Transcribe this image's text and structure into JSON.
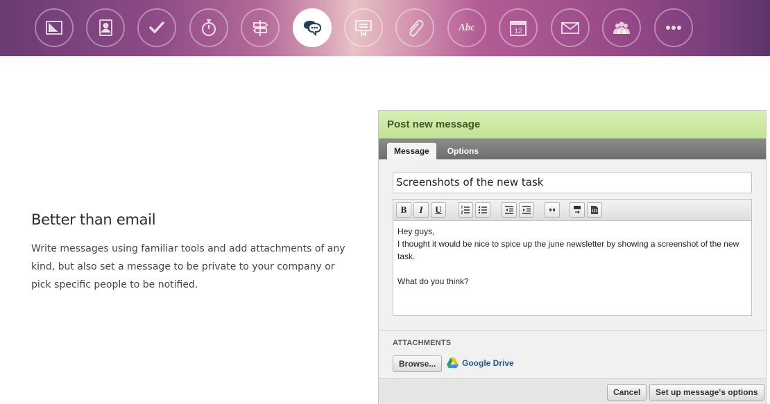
{
  "nav": {
    "icons": [
      {
        "name": "design-icon"
      },
      {
        "name": "contacts-icon"
      },
      {
        "name": "checkmark-icon"
      },
      {
        "name": "timer-icon"
      },
      {
        "name": "signpost-icon"
      },
      {
        "name": "messages-icon",
        "active": true
      },
      {
        "name": "notes-icon"
      },
      {
        "name": "attachment-icon"
      },
      {
        "name": "spelling-icon",
        "text": "Abc"
      },
      {
        "name": "calendar-icon",
        "text": "12"
      },
      {
        "name": "mail-icon"
      },
      {
        "name": "people-icon"
      },
      {
        "name": "more-icon"
      }
    ]
  },
  "feature": {
    "title": "Better than email",
    "description": "Write messages using familiar tools and add attachments of any kind, but also set a message to be private to your company or pick specific people to be notified."
  },
  "panel": {
    "title": "Post new message",
    "tabs": [
      "Message",
      "Options"
    ],
    "active_tab": "Message",
    "subject_value": "Screenshots of the new task",
    "toolbar": [
      {
        "name": "bold-button",
        "text": "B"
      },
      {
        "name": "italic-button",
        "text": "I"
      },
      {
        "name": "underline-button",
        "text": "U"
      },
      {
        "name": "ordered-list-icon"
      },
      {
        "name": "unordered-list-icon"
      },
      {
        "name": "outdent-icon"
      },
      {
        "name": "indent-icon"
      },
      {
        "name": "quote-icon"
      },
      {
        "name": "tab-icon"
      },
      {
        "name": "html-source-icon"
      }
    ],
    "body_lines": [
      "Hey guys,",
      "I thought it would be nice to spice up the june newsletter by showing a screenshot of the new task.",
      "",
      "What do you think?"
    ],
    "attachments_label": "ATTACHMENTS",
    "browse_label": "Browse...",
    "drive_label": "Google Drive",
    "cancel_label": "Cancel",
    "options_label": "Set up message's options"
  },
  "colors": {
    "header_green": "#c8e69c",
    "header_text": "#3f5a26",
    "tabbar_gray": "#7a7a7a",
    "drive_link": "#1f5d8e"
  }
}
